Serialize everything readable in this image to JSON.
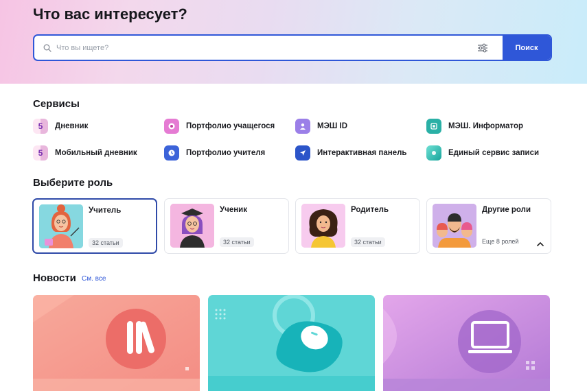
{
  "hero": {
    "title": "Что вас интересует?",
    "search_placeholder": "Что вы ищете?",
    "search_button": "Поиск"
  },
  "services": {
    "title": "Сервисы",
    "items": [
      {
        "label": "Дневник",
        "icon": "dnevnik-5-icon"
      },
      {
        "label": "Портфолио учащегося",
        "icon": "portfolio-student-icon"
      },
      {
        "label": "МЭШ ID",
        "icon": "mesh-id-icon"
      },
      {
        "label": "МЭШ. Информатор",
        "icon": "informator-icon"
      },
      {
        "label": "Мобильный дневник",
        "icon": "mobile-dnevnik-icon"
      },
      {
        "label": "Портфолио учителя",
        "icon": "portfolio-teacher-icon"
      },
      {
        "label": "Интерактивная панель",
        "icon": "interactive-panel-icon"
      },
      {
        "label": "Единый сервис записи",
        "icon": "registration-service-icon"
      }
    ]
  },
  "roles": {
    "title": "Выберите роль",
    "items": [
      {
        "name": "Учитель",
        "count": "32 статьи"
      },
      {
        "name": "Ученик",
        "count": "32 статьи"
      },
      {
        "name": "Родитель",
        "count": "32 статьи"
      },
      {
        "name": "Другие роли",
        "more": "Еще 8 ролей"
      }
    ]
  },
  "news": {
    "title": "Новости",
    "see_all": "См. все"
  },
  "colors": {
    "accent": "#2f57d8",
    "active_border": "#2f4aa8"
  }
}
